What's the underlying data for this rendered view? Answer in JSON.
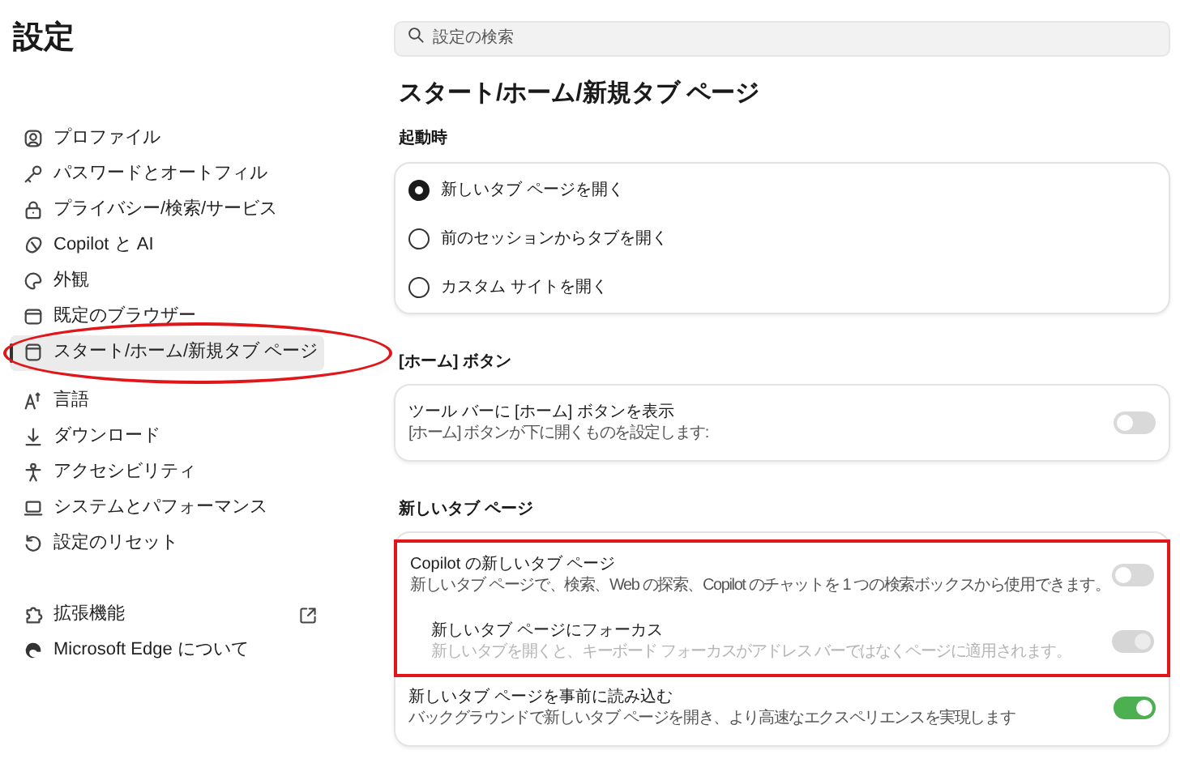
{
  "sidebar": {
    "title": "設定",
    "items": [
      {
        "label": "プロファイル",
        "selected": false,
        "circled": false
      },
      {
        "label": "パスワードとオートフィル",
        "selected": false,
        "circled": false
      },
      {
        "label": "プライバシー/検索/サービス",
        "selected": false,
        "circled": false
      },
      {
        "label": "Copilot と AI",
        "selected": false,
        "circled": false
      },
      {
        "label": "外観",
        "selected": false,
        "circled": false
      },
      {
        "label": "既定のブラウザー",
        "selected": false,
        "circled": false
      },
      {
        "label": "スタート/ホーム/新規タブ ページ",
        "selected": true,
        "circled": true
      },
      {
        "label": "言語",
        "selected": false,
        "circled": false
      },
      {
        "label": "ダウンロード",
        "selected": false,
        "circled": false
      },
      {
        "label": "アクセシビリティ",
        "selected": false,
        "circled": false
      },
      {
        "label": "システムとパフォーマンス",
        "selected": false,
        "circled": false
      },
      {
        "label": "設定のリセット",
        "selected": false,
        "circled": false
      }
    ],
    "footer_items": [
      {
        "label": "拡張機能",
        "external": true
      },
      {
        "label": "Microsoft Edge について",
        "external": false
      }
    ]
  },
  "search": {
    "placeholder": "設定の検索"
  },
  "page_title": "スタート/ホーム/新規タブ ページ",
  "startup": {
    "heading": "起動時",
    "options": [
      {
        "label": "新しいタブ ページを開く",
        "selected": true
      },
      {
        "label": "前のセッションからタブを開く",
        "selected": false
      },
      {
        "label": "カスタム サイトを開く",
        "selected": false
      }
    ]
  },
  "home_button": {
    "heading": "[ホーム] ボタン",
    "settings": [
      {
        "title": "ツール バーに [ホーム] ボタンを表示",
        "description": "[ホーム] ボタンが下に開くものを設定します:",
        "on": false,
        "disabled": false
      }
    ]
  },
  "new_tab": {
    "heading": "新しいタブ ページ",
    "highlighted_settings": [
      {
        "title": "Copilot の新しいタブ ページ",
        "description": "新しいタブ ページで、検索、Web の探索、Copilot のチャットを 1 つの検索ボックスから使用できます。",
        "on": false,
        "disabled": false,
        "indented": false
      },
      {
        "title": "新しいタブ ページにフォーカス",
        "description": "新しいタブを開くと、キーボード フォーカスがアドレス バーではなくページに適用されます。",
        "on": true,
        "disabled": true,
        "indented": true
      }
    ],
    "settings": [
      {
        "title": "新しいタブ ページを事前に読み込む",
        "description": "バックグラウンドで新しいタブ ページを開き、より高速なエクスペリエンスを実現します",
        "on": true,
        "disabled": false
      }
    ]
  }
}
